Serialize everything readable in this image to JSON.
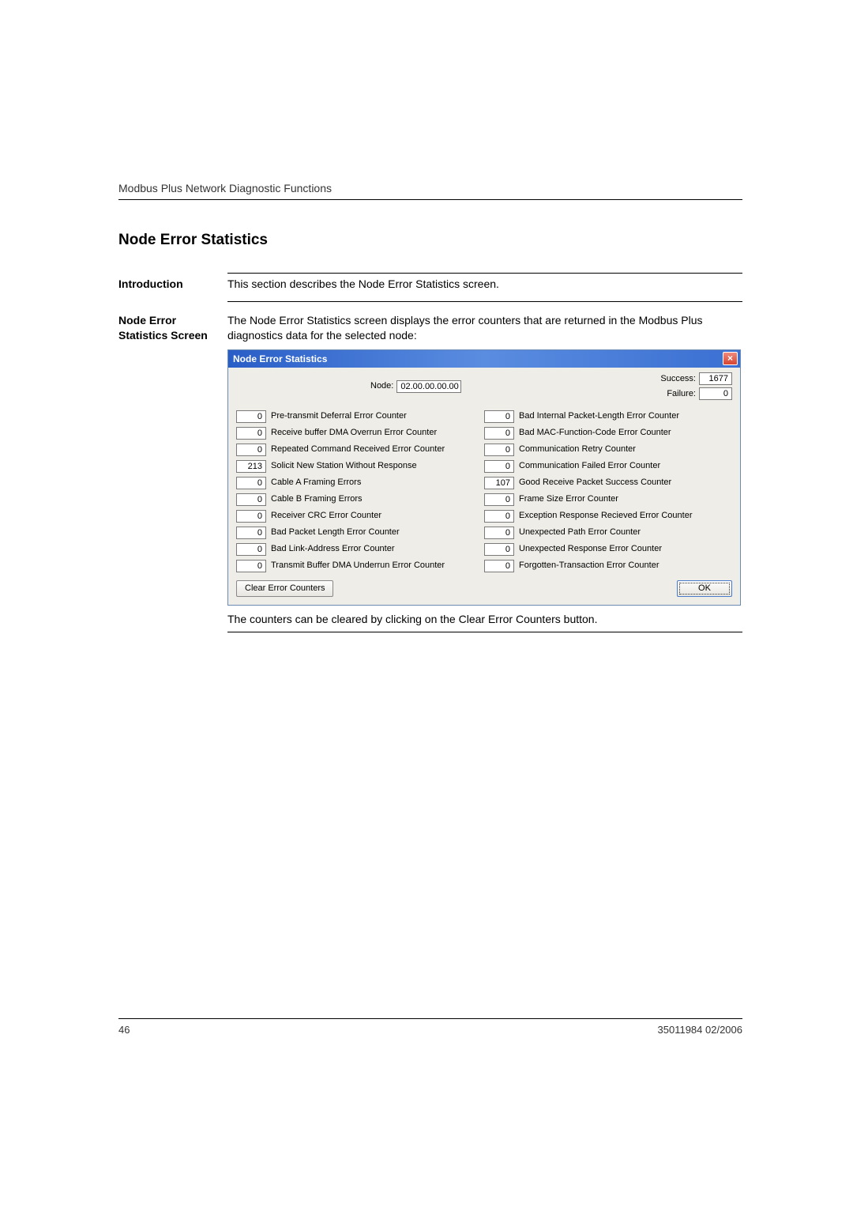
{
  "breadcrumb": "Modbus Plus Network Diagnostic Functions",
  "section_title": "Node Error Statistics",
  "intro": {
    "label": "Introduction",
    "text": "This section describes the Node Error Statistics screen."
  },
  "screen_desc": {
    "label": "Node Error Statistics Screen",
    "text": "The Node Error Statistics screen displays the error counters that are returned in the Modbus Plus diagnostics data for the selected node:"
  },
  "dialog": {
    "title": "Node Error Statistics",
    "close": "×",
    "node_label": "Node:",
    "node_value": "02.00.00.00.00",
    "success_label": "Success:",
    "success_value": "1677",
    "failure_label": "Failure:",
    "failure_value": "0",
    "counters_left": [
      {
        "val": "0",
        "lbl": "Pre-transmit Deferral Error Counter"
      },
      {
        "val": "0",
        "lbl": "Receive buffer DMA Overrun Error Counter"
      },
      {
        "val": "0",
        "lbl": "Repeated Command Received Error Counter"
      },
      {
        "val": "213",
        "lbl": "Solicit New Station Without Response"
      },
      {
        "val": "0",
        "lbl": "Cable A Framing Errors"
      },
      {
        "val": "0",
        "lbl": "Cable B Framing Errors"
      },
      {
        "val": "0",
        "lbl": "Receiver CRC Error Counter"
      },
      {
        "val": "0",
        "lbl": "Bad Packet Length Error Counter"
      },
      {
        "val": "0",
        "lbl": "Bad Link-Address Error Counter"
      },
      {
        "val": "0",
        "lbl": "Transmit Buffer DMA Underrun Error Counter"
      }
    ],
    "counters_right": [
      {
        "val": "0",
        "lbl": "Bad Internal Packet-Length Error Counter"
      },
      {
        "val": "0",
        "lbl": "Bad MAC-Function-Code Error Counter"
      },
      {
        "val": "0",
        "lbl": "Communication Retry Counter"
      },
      {
        "val": "0",
        "lbl": "Communication Failed Error Counter"
      },
      {
        "val": "107",
        "lbl": "Good Receive Packet Success Counter"
      },
      {
        "val": "0",
        "lbl": "Frame Size Error Counter"
      },
      {
        "val": "0",
        "lbl": "Exception Response Recieved Error Counter"
      },
      {
        "val": "0",
        "lbl": "Unexpected Path Error Counter"
      },
      {
        "val": "0",
        "lbl": "Unexpected Response Error Counter"
      },
      {
        "val": "0",
        "lbl": "Forgotten-Transaction Error Counter"
      }
    ],
    "clear_btn": "Clear Error Counters",
    "ok_btn": "OK"
  },
  "caption": "The counters can be cleared by clicking on the Clear Error Counters button.",
  "footer": {
    "page": "46",
    "docid": "35011984 02/2006"
  }
}
